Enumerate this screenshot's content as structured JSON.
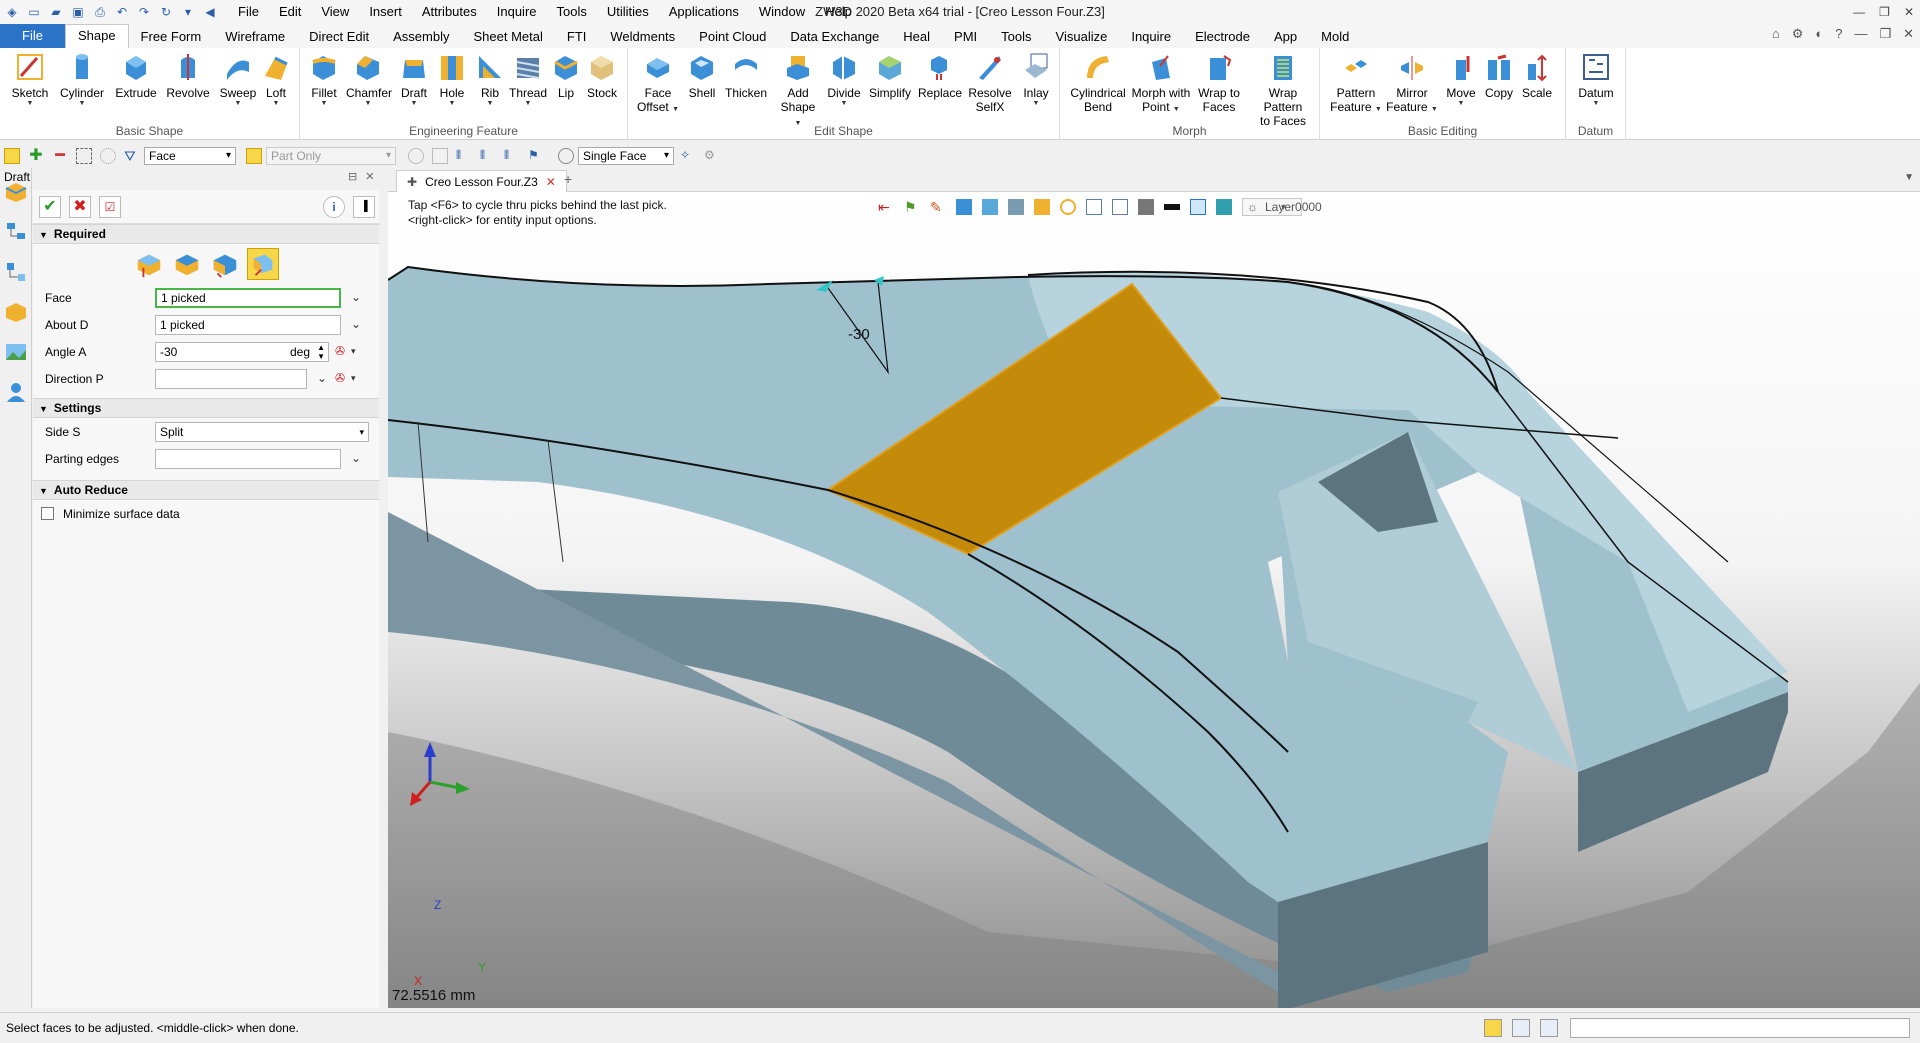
{
  "window": {
    "title": "ZW3D 2020 Beta x64 trial - [Creo Lesson Four.Z3]",
    "menu": [
      "File",
      "Edit",
      "View",
      "Insert",
      "Attributes",
      "Inquire",
      "Tools",
      "Utilities",
      "Applications",
      "Window",
      "Help"
    ]
  },
  "ribbon_tabs": [
    "File",
    "Shape",
    "Free Form",
    "Wireframe",
    "Direct Edit",
    "Assembly",
    "Sheet Metal",
    "FTI",
    "Weldments",
    "Point Cloud",
    "Data Exchange",
    "Heal",
    "PMI",
    "Tools",
    "Visualize",
    "Inquire",
    "Electrode",
    "App",
    "Mold"
  ],
  "ribbon_active_tab": "Shape",
  "ribbon": {
    "basic_shape": {
      "label": "Basic Shape",
      "buttons": [
        "Sketch",
        "Cylinder",
        "Extrude",
        "Revolve",
        "Sweep",
        "Loft"
      ]
    },
    "engineering_feature": {
      "label": "Engineering Feature",
      "buttons": [
        "Fillet",
        "Chamfer",
        "Draft",
        "Hole",
        "Rib",
        "Thread",
        "Lip",
        "Stock"
      ]
    },
    "edit_shape": {
      "label": "Edit Shape",
      "buttons": [
        {
          "l1": "Face",
          "l2": "Offset"
        },
        {
          "l1": "Shell",
          "l2": ""
        },
        {
          "l1": "Thicken",
          "l2": ""
        },
        {
          "l1": "Add",
          "l2": "Shape"
        },
        {
          "l1": "Divide",
          "l2": ""
        },
        {
          "l1": "Simplify",
          "l2": ""
        },
        {
          "l1": "Replace",
          "l2": ""
        },
        {
          "l1": "Resolve",
          "l2": "SelfX"
        },
        {
          "l1": "Inlay",
          "l2": ""
        }
      ]
    },
    "morph": {
      "label": "Morph",
      "buttons": [
        {
          "l1": "Cylindrical",
          "l2": "Bend"
        },
        {
          "l1": "Morph with",
          "l2": "Point"
        },
        {
          "l1": "Wrap to",
          "l2": "Faces"
        },
        {
          "l1": "Wrap Pattern",
          "l2": "to Faces"
        }
      ]
    },
    "basic_editing": {
      "label": "Basic Editing",
      "buttons": [
        {
          "l1": "Pattern",
          "l2": "Feature"
        },
        {
          "l1": "Mirror",
          "l2": "Feature"
        },
        {
          "l1": "Move",
          "l2": ""
        },
        {
          "l1": "Copy",
          "l2": ""
        },
        {
          "l1": "Scale",
          "l2": ""
        }
      ]
    },
    "datum": {
      "label": "Datum",
      "buttons": [
        "Datum"
      ]
    }
  },
  "toolbar": {
    "filter_value": "Face",
    "scope_value": "Part Only",
    "pick_mode": "Single Face"
  },
  "panel": {
    "title": "Draft",
    "sections": {
      "required": "Required",
      "settings": "Settings",
      "auto_reduce": "Auto Reduce"
    },
    "fields": {
      "face_label": "Face",
      "face_value": "1 picked",
      "about_label": "About D",
      "about_value": "1 picked",
      "angle_label": "Angle A",
      "angle_value": "-30",
      "angle_unit": "deg",
      "direction_label": "Direction P",
      "direction_value": "",
      "side_label": "Side S",
      "side_value": "Split",
      "parting_label": "Parting edges",
      "parting_value": "",
      "minimize_label": "Minimize surface data"
    }
  },
  "document": {
    "tab": "Creo Lesson Four.Z3",
    "hint_line1": "Tap <F6> to cycle thru picks behind the last pick.",
    "hint_line2": "<right-click> for entity input options.",
    "layer": "Layer0000",
    "dimension_label": "-30",
    "scale_text": "72.5516 mm",
    "axis_x": "X",
    "axis_y": "Y",
    "axis_z": "Z"
  },
  "status": {
    "message": "Select faces to be adjusted.  <middle-click> when done."
  },
  "colors": {
    "file_tab": "#2b73c7",
    "part_face": "#9fc0cd",
    "part_face_light": "#b6d3de",
    "part_side": "#5c7480",
    "selected_face": "#c48a0a",
    "background_top": "#ffffff",
    "background_bottom": "#9a9a9a"
  }
}
